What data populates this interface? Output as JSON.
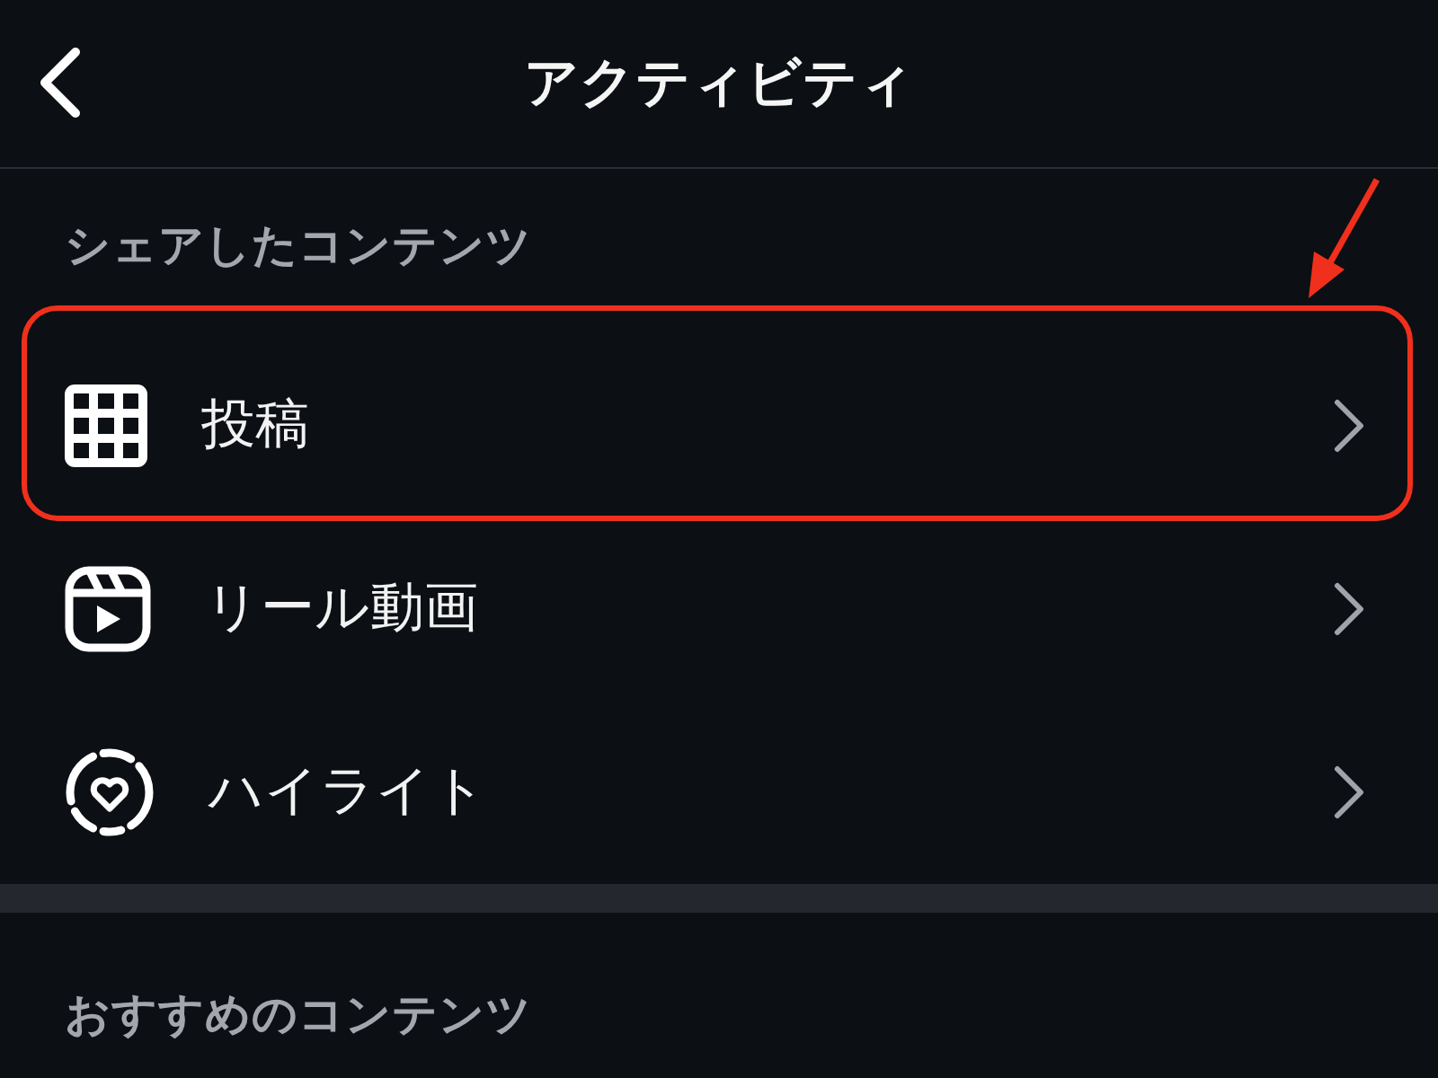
{
  "header": {
    "title": "アクティビティ"
  },
  "sections": [
    {
      "title": "シェアしたコンテンツ",
      "items": [
        {
          "label": "投稿",
          "highlighted": true
        },
        {
          "label": "リール動画",
          "highlighted": false
        },
        {
          "label": "ハイライト",
          "highlighted": false
        }
      ]
    },
    {
      "title": "おすすめのコンテンツ"
    }
  ]
}
